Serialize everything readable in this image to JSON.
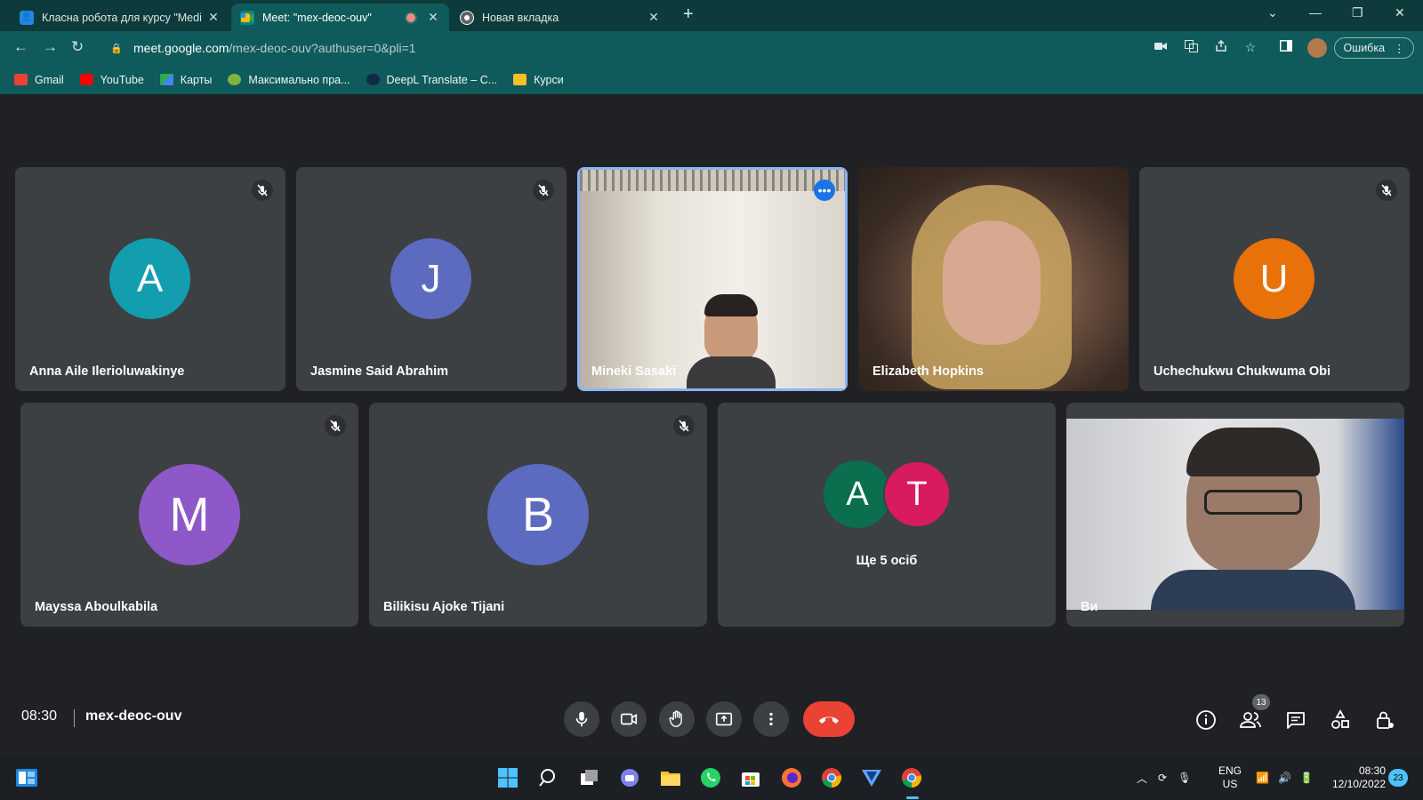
{
  "browser": {
    "tabs": [
      {
        "title": "Класна робота для курсу \"Medi",
        "active": false
      },
      {
        "title": "Meet: \"mex-deoc-ouv\"",
        "active": true
      },
      {
        "title": "Новая вкладка",
        "active": false
      }
    ],
    "url_host": "meet.google.com",
    "url_path": "/mex-deoc-ouv?authuser=0&pli=1",
    "error_button_label": "Ошибка",
    "bookmarks": [
      {
        "label": "Gmail",
        "icon": "gmail-icon",
        "color": "#ea4335"
      },
      {
        "label": "YouTube",
        "icon": "youtube-icon",
        "color": "#ff0000"
      },
      {
        "label": "Карты",
        "icon": "maps-icon",
        "color": "#34a853"
      },
      {
        "label": "Максимально пра...",
        "icon": "bookmark-icon",
        "color": "#9aa0a6"
      },
      {
        "label": "DeepL Translate – C...",
        "icon": "deepl-icon",
        "color": "#0f2b46"
      },
      {
        "label": "Курси",
        "icon": "classroom-icon",
        "color": "#f6c026"
      }
    ]
  },
  "meet": {
    "participants_row1": [
      {
        "name": "Anna Aile Ilerioluwakinye",
        "initial": "A",
        "color": "#129eaf",
        "muted": true,
        "video": false
      },
      {
        "name": "Jasmine Said Abrahim",
        "initial": "J",
        "color": "#5c6bc0",
        "muted": true,
        "video": false
      },
      {
        "name": "Mineki Sasaki",
        "initial": "",
        "color": "",
        "muted": false,
        "video": true,
        "speaking": true
      },
      {
        "name": "Elizabeth Hopkins",
        "initial": "",
        "color": "",
        "muted": false,
        "video": true
      },
      {
        "name": "Uchechukwu Chukwuma Obi",
        "initial": "U",
        "color": "#e8710a",
        "muted": true,
        "video": false
      }
    ],
    "participants_row2": [
      {
        "name": "Mayssa Aboulkabila",
        "initial": "M",
        "color": "#8e58c9",
        "muted": true,
        "video": false
      },
      {
        "name": "Bilikisu Ajoke Tijani",
        "initial": "B",
        "color": "#5c6bc0",
        "muted": true,
        "video": false
      },
      {
        "name": "Ще 5 осіб",
        "initials": [
          "A",
          "T"
        ],
        "colors": [
          "#0b6e4f",
          "#d81b60"
        ],
        "group": true
      },
      {
        "name": "Ви",
        "video": true,
        "self": true
      }
    ],
    "time": "08:30",
    "meeting_code": "mex-deoc-ouv",
    "participant_count": "13"
  },
  "taskbar": {
    "lang_top": "ENG",
    "lang_bottom": "US",
    "time": "08:30",
    "date": "12/10/2022",
    "notifications": "23"
  }
}
